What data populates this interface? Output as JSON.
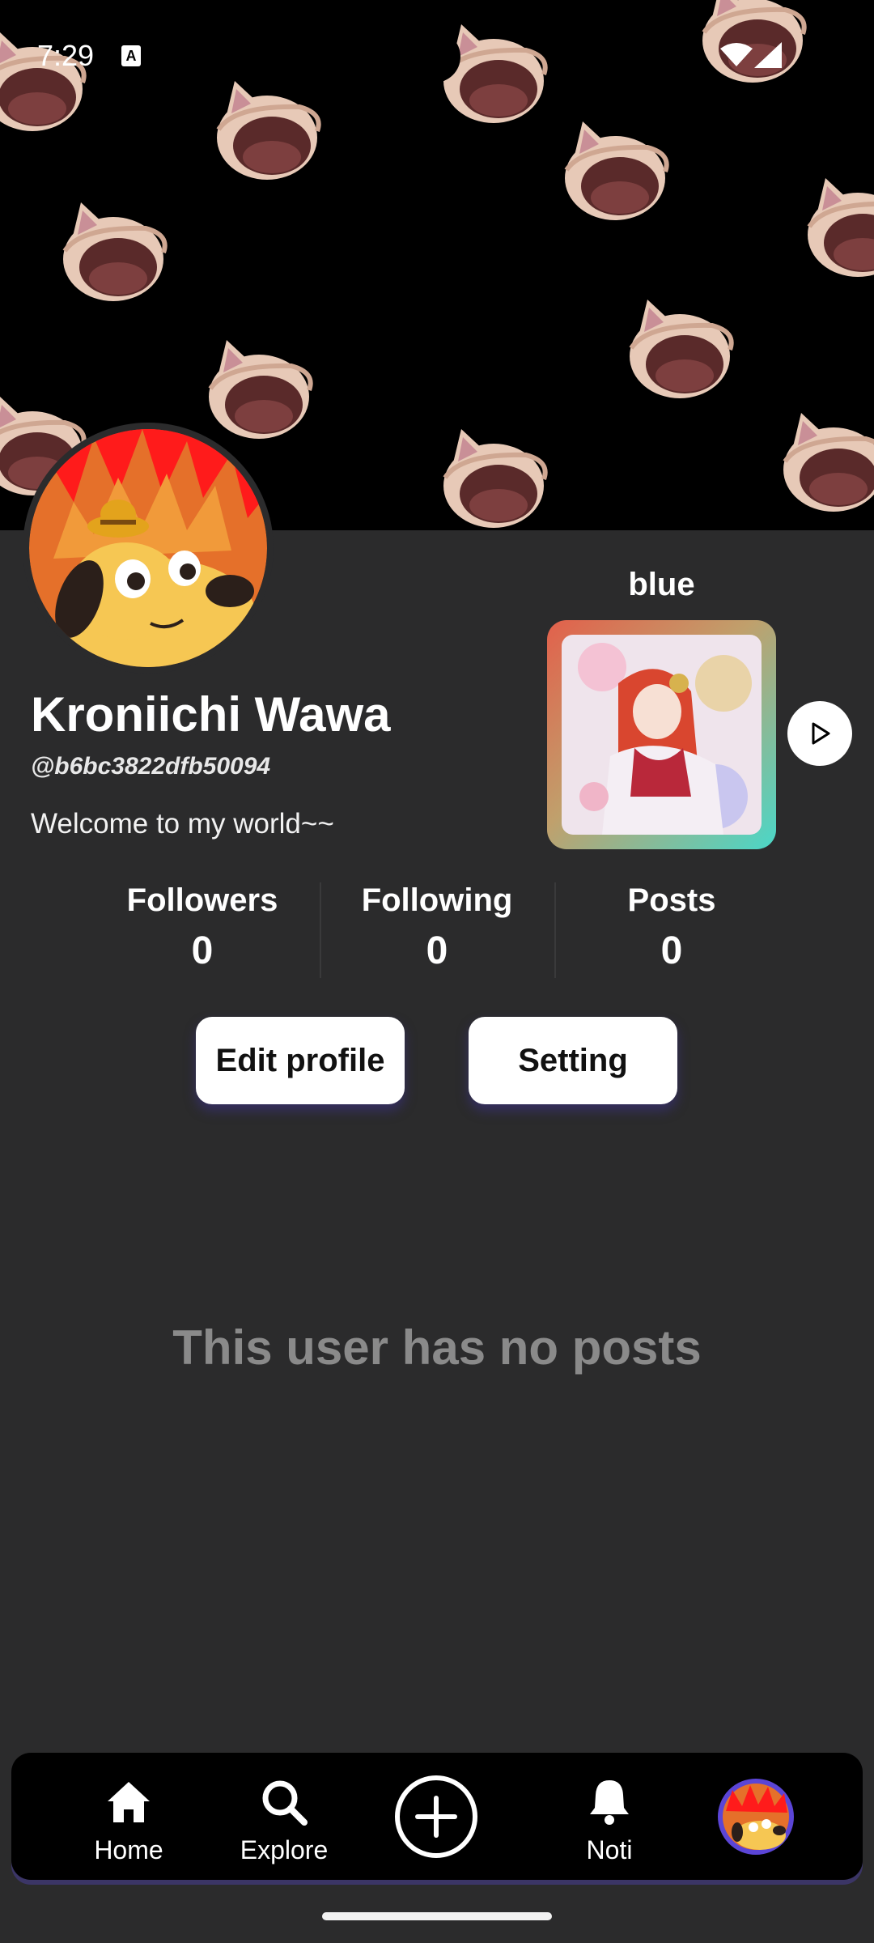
{
  "status_bar": {
    "time": "7:29",
    "badge": "A"
  },
  "profile": {
    "name": "Kroniichi Wawa",
    "handle": "@b6bc3822dfb50094",
    "bio": "Welcome to my world~~"
  },
  "music": {
    "title": "blue"
  },
  "stats": [
    {
      "label": "Followers",
      "value": "0"
    },
    {
      "label": "Following",
      "value": "0"
    },
    {
      "label": "Posts",
      "value": "0"
    }
  ],
  "buttons": {
    "edit": "Edit profile",
    "setting": "Setting"
  },
  "empty_state": "This user has no posts",
  "nav": [
    {
      "label": "Home",
      "icon": "home-icon"
    },
    {
      "label": "Explore",
      "icon": "search-icon"
    },
    {
      "label": "",
      "icon": "plus-circle-icon"
    },
    {
      "label": "Noti",
      "icon": "bell-icon"
    },
    {
      "label": "",
      "icon": "profile-avatar-icon"
    }
  ],
  "colors": {
    "background": "#2b2b2c",
    "banner": "#000000",
    "nav_accent": "#5b45d6"
  }
}
